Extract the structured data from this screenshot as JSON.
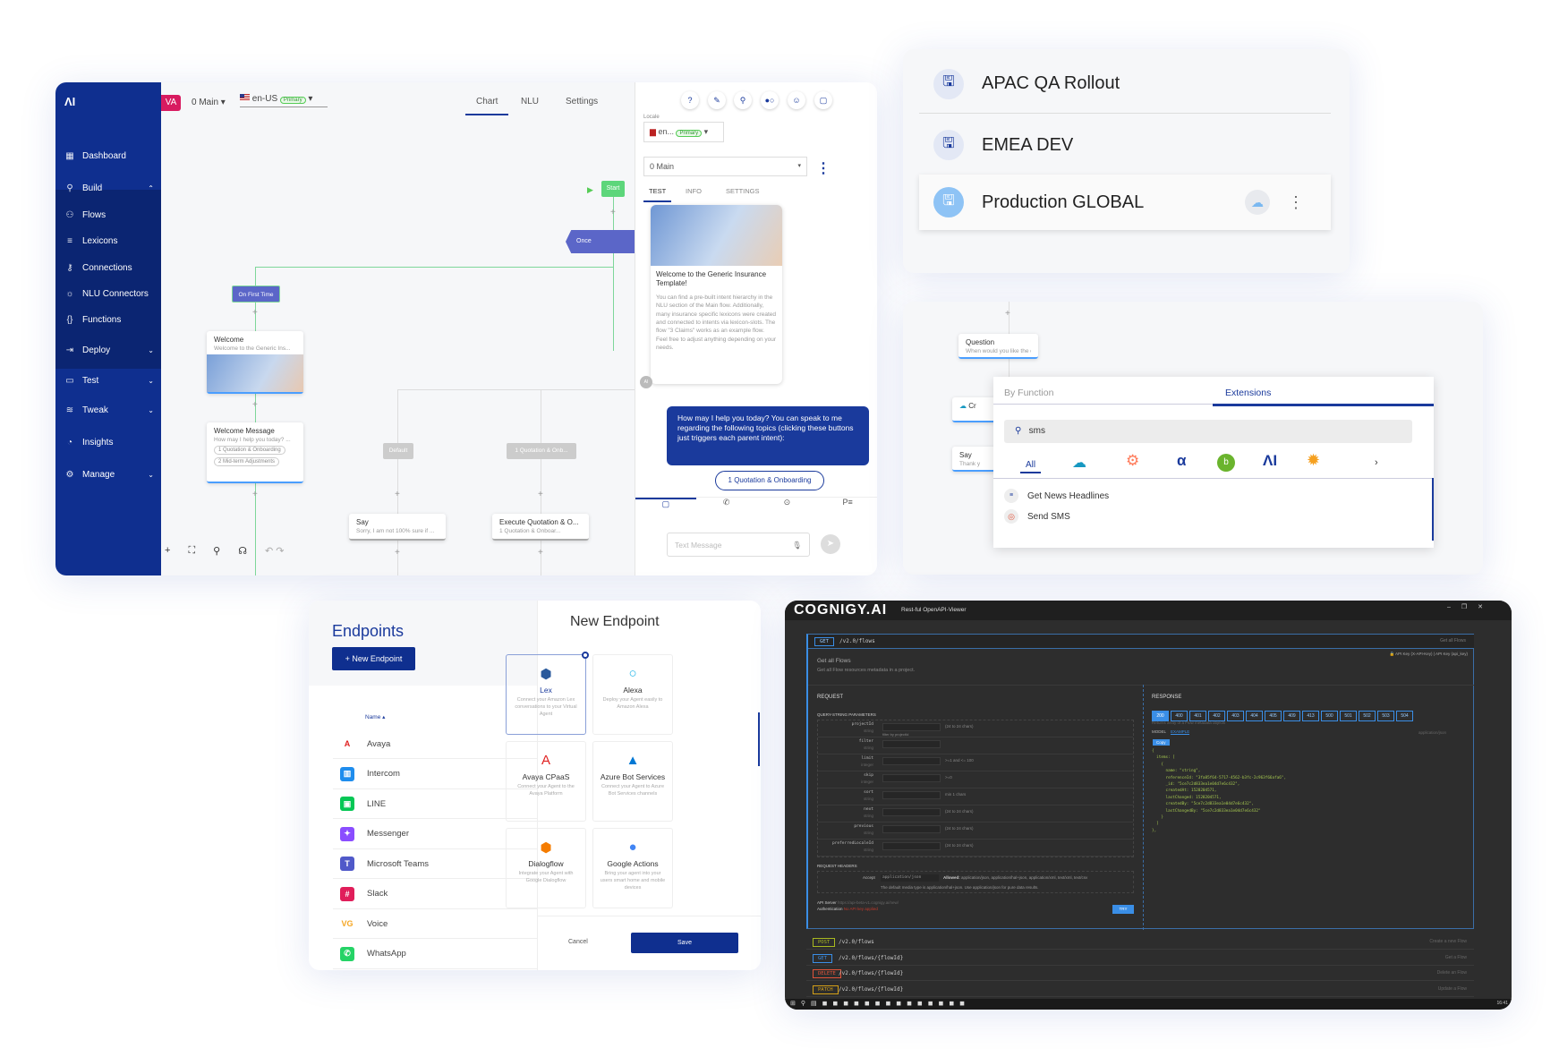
{
  "flow_editor": {
    "logo": "ΛI",
    "sidebar": [
      {
        "label": "Dashboard",
        "icon": "grid-icon"
      },
      {
        "label": "Build",
        "icon": "build-icon",
        "expanded": true
      },
      {
        "label": "Flows",
        "icon": "flows-icon"
      },
      {
        "label": "Lexicons",
        "icon": "lexicons-icon"
      },
      {
        "label": "Connections",
        "icon": "connections-icon"
      },
      {
        "label": "NLU Connectors",
        "icon": "bulb-icon"
      },
      {
        "label": "Functions",
        "icon": "braces-icon"
      },
      {
        "label": "Deploy",
        "icon": "deploy-icon"
      },
      {
        "label": "Test",
        "icon": "test-icon"
      },
      {
        "label": "Tweak",
        "icon": "tweak-icon"
      },
      {
        "label": "Insights",
        "icon": "insights-icon"
      },
      {
        "label": "Manage",
        "icon": "gear-icon"
      }
    ],
    "agent_badge": "VA",
    "flow_select": "0 Main",
    "locale": "en-US",
    "primary": "Primary",
    "tabs": [
      "Chart",
      "NLU",
      "Settings"
    ],
    "active_tab": "Chart",
    "nodes": {
      "start": "Start",
      "once": "Once",
      "on_first_time": "On First Time",
      "welcome_title": "Welcome",
      "welcome_sub": "Welcome to the Generic Ins...",
      "wm_title": "Welcome Message",
      "wm_sub": "How may I help you today? ...",
      "wm_btn1": "1 Quotation & Onboarding",
      "wm_btn2": "2 Mid-term Adjustments",
      "default": "Default",
      "quote_case": "1 Quotation & Onb...",
      "say_title": "Say",
      "say_sub": "Sorry, I am not 100% sure if ...",
      "exec_title": "Execute Quotation & O...",
      "exec_sub": "1 Quotation & Onboar..."
    },
    "chat": {
      "locale_label": "Locale",
      "locale_short": "en...",
      "primary": "Primary",
      "flow": "0 Main",
      "tabs": [
        "TEST",
        "INFO",
        "SETTINGS"
      ],
      "card_title": "Welcome to the Generic Insurance Template!",
      "card_body": "You can find a pre-built intent hierarchy in the NLU section of the Main flow. Additionally, many insurance specific lexicons were created and connected to intents via lexicon-slots. The flow \"3 Claims\" works as an example flow. Feel free to adjust anything depending on your needs.",
      "bot_avatar": "AI",
      "bubble": "How may I help you today? You can speak to me regarding the following topics (clicking these buttons just triggers each parent intent):",
      "quick_reply": "1 Quotation & Onboarding",
      "input_placeholder": "Text Message"
    }
  },
  "snapshots": [
    {
      "name": "APAC QA Rollout"
    },
    {
      "name": "EMEA DEV"
    },
    {
      "name": "Production GLOBAL",
      "selected": true
    }
  ],
  "extensions": {
    "node_question_title": "Question",
    "node_question_sub": "When would you like the de...",
    "node_cr": "Cr",
    "node_cr_sub": "De",
    "node_say": "Say",
    "node_say_sub": "Thank y",
    "tabs": [
      "By Function",
      "Extensions"
    ],
    "active_tab": "Extensions",
    "search": "sms",
    "filters": [
      "All",
      "salesforce",
      "hubspot",
      "alpha",
      "bamboo",
      "cognigy",
      "sun"
    ],
    "results": [
      "Get News Headlines",
      "Send SMS"
    ]
  },
  "endpoints": {
    "title": "Endpoints",
    "new_button": "New Endpoint",
    "sort_col": "Name",
    "list": [
      {
        "name": "Avaya",
        "color": "#e02020",
        "glyph": "A"
      },
      {
        "name": "Intercom",
        "color": "#1f8ded",
        "glyph": "▥"
      },
      {
        "name": "LINE",
        "color": "#06c755",
        "glyph": "▣"
      },
      {
        "name": "Messenger",
        "color": "#8a4dff",
        "glyph": "✦"
      },
      {
        "name": "Microsoft Teams",
        "color": "#5059c9",
        "glyph": "T"
      },
      {
        "name": "Slack",
        "color": "#e01e5a",
        "glyph": "#"
      },
      {
        "name": "Voice",
        "color": "#f5a623",
        "glyph": "VG"
      },
      {
        "name": "WhatsApp",
        "color": "#25d366",
        "glyph": "✆"
      }
    ],
    "modal_title": "New Endpoint",
    "cards": [
      {
        "name": "Lex",
        "desc": "Connect your Amazon Lex conversations to your Virtual Agent",
        "selected": true
      },
      {
        "name": "Alexa",
        "desc": "Deploy your Agent easily to Amazon Alexa"
      },
      {
        "name": "Avaya CPaaS",
        "desc": "Connect your Agent to the Avaya Platform"
      },
      {
        "name": "Azure Bot Services",
        "desc": "Connect your Agent to Azure Bot Services channels"
      },
      {
        "name": "Dialogflow",
        "desc": "Integrate your Agent with Google Dialogflow"
      },
      {
        "name": "Google Actions",
        "desc": "Bring your agent into your users smart home and mobile devices"
      }
    ],
    "cancel": "Cancel",
    "save": "Save"
  },
  "api_viewer": {
    "logo": "COGNIGY.AI",
    "subtitle": "Rest-ful OpenAPI-Viewer",
    "op_method": "GET",
    "op_path": "/v2.0/flows",
    "op_summary": "Get all Flows",
    "title": "Get all Flows",
    "desc": "Get all Flow resources metadata in a project.",
    "auth_keys": [
      "API Key (X-API-Key)",
      "API Key (api_key)"
    ],
    "request": "REQUEST",
    "query_params_label": "QUERY-STRING PARAMETERS",
    "params": [
      {
        "name": "projectId",
        "type": "string",
        "hint": "(24 to 24 chars)",
        "note": "filter by projectId"
      },
      {
        "name": "filter",
        "type": "string",
        "hint": ""
      },
      {
        "name": "limit",
        "type": "integer",
        "hint": ">=1 and <= 100"
      },
      {
        "name": "skip",
        "type": "integer",
        "hint": ">=0"
      },
      {
        "name": "sort",
        "type": "string",
        "hint": "min 1 chars"
      },
      {
        "name": "next",
        "type": "string",
        "hint": "(24 to 24 chars)"
      },
      {
        "name": "previous",
        "type": "string",
        "hint": "(24 to 24 chars)"
      },
      {
        "name": "preferredLocaleId",
        "type": "string",
        "hint": "(24 to 24 chars)"
      }
    ],
    "headers_label": "REQUEST HEADERS",
    "accept_name": "Accept",
    "accept_type": "enum",
    "accept_value": "application/json",
    "allowed_label": "Allowed:",
    "allowed": "application/json, application/hal+json, application/xml, text/xml, text/csv",
    "accept_note": "The default media type is application/hal+json. Use application/json for pure data results.",
    "api_server_label": "API Server",
    "api_server": "https://api-beta-v1.cognigy.ai/new/",
    "auth_label": "Authentication",
    "auth_value": "No API key applied",
    "try": "TRY",
    "response": "RESPONSE",
    "codes": [
      "200",
      "400",
      "401",
      "402",
      "403",
      "404",
      "405",
      "409",
      "413",
      "500",
      "501",
      "502",
      "503",
      "504"
    ],
    "response_desc": "Returns array of a Flow metadata objects",
    "resp_tabs": [
      "MODEL",
      "EXAMPLE"
    ],
    "content_type": "application/json",
    "copy": "Copy",
    "example": "{\n  items: [\n    {\n      name: \"string\",\n      referenceId: \"3fa85f64-5717-4562-b3fc-2c963f66afa6\",\n      _id: \"5ce7c2d833ea1e04d7e6c432\",\n      createdAt: 1528204571,\n      lastChanged: 1528204571,\n      createdBy: \"5ce7c2d833ea1e04d7e6c432\",\n      lastChangedBy: \"5ce7c2d833ea1e04d7e6c432\"\n    }\n  ]\n},",
    "ops": [
      {
        "method": "POST",
        "path": "/v2.0/flows",
        "summary": "Create a new Flow",
        "color": "#a8b820"
      },
      {
        "method": "GET",
        "path": "/v2.0/flows/{flowId}",
        "summary": "Get a Flow",
        "color": "#3a8ee6"
      },
      {
        "method": "DELETE",
        "path": "/v2.0/flows/{flowId}",
        "summary": "Delete an Flow",
        "color": "#e0533a"
      },
      {
        "method": "PATCH",
        "path": "/v2.0/flows/{flowId}",
        "summary": "Update a Flow",
        "color": "#d4a017"
      }
    ],
    "clock": "16:41"
  }
}
